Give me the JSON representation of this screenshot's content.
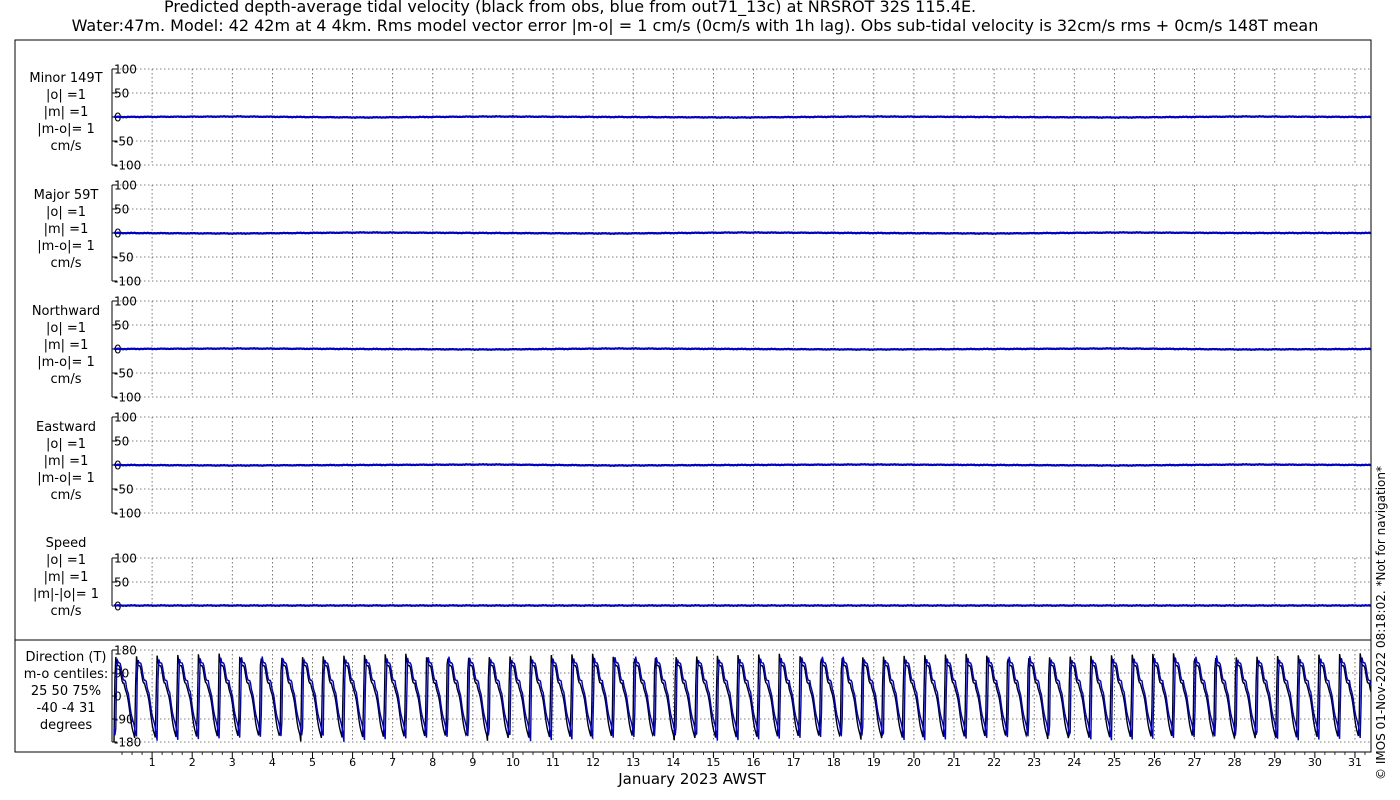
{
  "title": {
    "line1": "Predicted depth-average tidal velocity (black from obs, blue from out71_13c) at NRSROT 32S 115.4E.",
    "line2": "Water:47m. Model: 42 42m at 4 4km. Rms model vector error |m-o| = 1 cm/s (0cm/s with 1h lag). Obs sub-tidal velocity is 32cm/s rms + 0cm/s 148T mean"
  },
  "footer": "© IMOS 01-Nov-2022 08:18:02. *Not for navigation*",
  "colors": {
    "obs": "#000000",
    "model": "#0000cc",
    "grid": "#555555"
  },
  "chart_data": [
    {
      "type": "line",
      "id": "minor",
      "label_lines": [
        "Minor 149T",
        "|o| =1",
        "|m| =1",
        "|m-o|= 1",
        "cm/s"
      ],
      "ylim": [
        -100,
        100
      ],
      "yticks": [
        100,
        50,
        0,
        -50,
        -100
      ],
      "ytick_labels": [
        "100",
        "50",
        "0",
        "-50",
        "-100"
      ],
      "series": [
        {
          "color": "obs",
          "values": [
            0,
            1,
            -1,
            1,
            0,
            -1,
            1,
            0,
            -1,
            1,
            0
          ]
        },
        {
          "color": "model",
          "values": [
            0,
            1,
            -1,
            1,
            0,
            -1,
            1,
            0,
            -1,
            1,
            0
          ]
        }
      ]
    },
    {
      "type": "line",
      "id": "major",
      "label_lines": [
        "Major 59T",
        "|o| =1",
        "|m| =1",
        "|m-o|= 1",
        "cm/s"
      ],
      "ylim": [
        -100,
        100
      ],
      "yticks": [
        100,
        50,
        0,
        -50,
        -100
      ],
      "ytick_labels": [
        "100",
        "50",
        "0",
        "-50",
        "-100"
      ],
      "series": [
        {
          "color": "obs",
          "values": [
            0,
            -1,
            1,
            0,
            -1,
            1,
            0,
            -1,
            1,
            0,
            0
          ]
        },
        {
          "color": "model",
          "values": [
            0,
            -1,
            1,
            0,
            -1,
            1,
            0,
            -1,
            1,
            0,
            0
          ]
        }
      ]
    },
    {
      "type": "line",
      "id": "northward",
      "label_lines": [
        "Northward",
        "|o| =1",
        "|m| =1",
        "|m-o|= 1",
        "cm/s"
      ],
      "ylim": [
        -100,
        100
      ],
      "yticks": [
        100,
        50,
        0,
        -50,
        -100
      ],
      "ytick_labels": [
        "100",
        "50",
        "0",
        "-50",
        "-100"
      ],
      "series": [
        {
          "color": "obs",
          "values": [
            0,
            1,
            0,
            -1,
            1,
            0,
            -1,
            0,
            1,
            -1,
            0
          ]
        },
        {
          "color": "model",
          "values": [
            0,
            1,
            0,
            -1,
            1,
            0,
            -1,
            0,
            1,
            -1,
            0
          ]
        }
      ]
    },
    {
      "type": "line",
      "id": "eastward",
      "label_lines": [
        "Eastward",
        "|o| =1",
        "|m| =1",
        "|m-o|= 1",
        "cm/s"
      ],
      "ylim": [
        -100,
        100
      ],
      "yticks": [
        100,
        50,
        0,
        -50,
        -100
      ],
      "ytick_labels": [
        "100",
        "50",
        "0",
        "-50",
        "-100"
      ],
      "series": [
        {
          "color": "obs",
          "values": [
            0,
            -1,
            0,
            1,
            -1,
            0,
            1,
            0,
            -1,
            1,
            0
          ]
        },
        {
          "color": "model",
          "values": [
            0,
            -1,
            0,
            1,
            -1,
            0,
            1,
            0,
            -1,
            1,
            0
          ]
        }
      ]
    },
    {
      "type": "line",
      "id": "speed",
      "label_lines": [
        "Speed",
        "|o| =1",
        "|m| =1",
        "|m|-|o|= 1",
        "cm/s"
      ],
      "ylim": [
        0,
        100
      ],
      "yticks": [
        100,
        50,
        0
      ],
      "ytick_labels": [
        "100",
        "50",
        "0"
      ],
      "series": [
        {
          "color": "obs",
          "values": [
            1,
            1,
            1,
            1,
            1,
            1,
            1,
            1,
            1,
            1,
            1
          ]
        },
        {
          "color": "model",
          "values": [
            1,
            1,
            1,
            1,
            1,
            1,
            1,
            1,
            1,
            1,
            1
          ]
        }
      ]
    },
    {
      "type": "line",
      "id": "direction",
      "label_lines": [
        "Direction (T)",
        "m-o centiles:",
        "25  50  75%",
        "-40  -4  31",
        "degrees"
      ],
      "ylim": [
        -180,
        180
      ],
      "yticks": [
        180,
        90,
        0,
        -90,
        -180
      ],
      "ytick_labels": [
        "180",
        "90",
        "0",
        "-90",
        "-180"
      ],
      "cycle_days": 0.5175,
      "phase_days": 0.05,
      "series": [
        {
          "color": "obs",
          "name_hidden": true,
          "lag_days": 0.0
        },
        {
          "color": "model",
          "name_hidden": true,
          "lag_days": 0.04
        }
      ]
    }
  ],
  "x_axis": {
    "label": "January 2023 AWST",
    "range_days": [
      0,
      31.4
    ],
    "tick_days": [
      1,
      2,
      3,
      4,
      5,
      6,
      7,
      8,
      9,
      10,
      11,
      12,
      13,
      14,
      15,
      16,
      17,
      18,
      19,
      20,
      21,
      22,
      23,
      24,
      25,
      26,
      27,
      28,
      29,
      30,
      31
    ],
    "tick_labels": [
      "1",
      "2",
      "3",
      "4",
      "5",
      "6",
      "7",
      "8",
      "9",
      "10",
      "11",
      "12",
      "13",
      "14",
      "15",
      "16",
      "17",
      "18",
      "19",
      "20",
      "21",
      "22",
      "23",
      "24",
      "25",
      "26",
      "27",
      "28",
      "29",
      "30",
      "31"
    ]
  }
}
